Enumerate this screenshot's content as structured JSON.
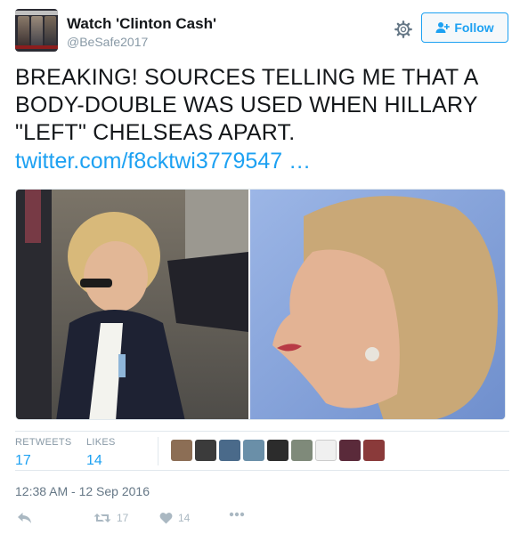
{
  "author": {
    "name": "Watch 'Clinton Cash'",
    "handle": "@BeSafe2017"
  },
  "follow_label": "Follow",
  "tweet": {
    "text_lines": [
      "BREAKING! SOURCES TELLING ME THAT A",
      "BODY-DOUBLE WAS USED WHEN HILLARY",
      "\"LEFT\" CHELSEAS APART."
    ],
    "link": "twitter.com/f8cktwi3779547 …"
  },
  "stats": {
    "retweets_label": "RETWEETS",
    "retweets": "17",
    "likes_label": "LIKES",
    "likes": "14"
  },
  "timestamp": "12:38 AM - 12 Sep 2016",
  "actions": {
    "retweet_count": "17",
    "like_count": "14"
  },
  "colors": {
    "accent": "#1da1f2",
    "muted": "#8899a6"
  },
  "icons": [
    "gear-icon",
    "follow-user-icon",
    "reply-icon",
    "retweet-icon",
    "heart-icon",
    "more-icon"
  ]
}
